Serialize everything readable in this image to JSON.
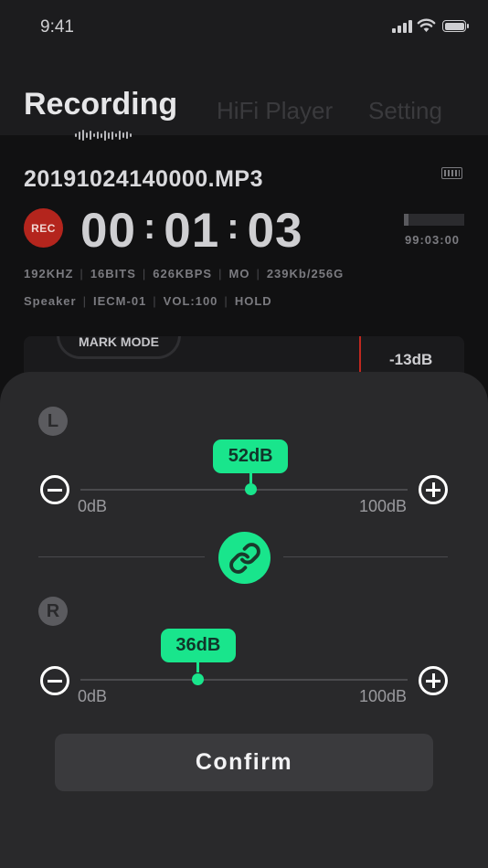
{
  "status_bar": {
    "time": "9:41"
  },
  "tabs": [
    {
      "label": "Recording",
      "active": true
    },
    {
      "label": "HiFi Player",
      "active": false
    },
    {
      "label": "Setting",
      "active": false
    }
  ],
  "recording": {
    "filename": "20191024140000.MP3",
    "rec_badge": "REC",
    "timer": {
      "hours": "00",
      "minutes": "01",
      "seconds": "03"
    },
    "remaining": "99:03:00",
    "level_fraction": 0.08,
    "info_line1": [
      "192KHZ",
      "16BITS",
      "626KBPS",
      "MO",
      "239Kb/256G"
    ],
    "info_line2": [
      "Speaker",
      "IECM-01",
      "VOL:100",
      "HOLD"
    ],
    "mark_mode": "MARK MODE",
    "db_level": "-13dB"
  },
  "gain_sheet": {
    "left": {
      "channel": "L",
      "value_label": "52dB",
      "value": 52,
      "min_label": "0dB",
      "max_label": "100dB"
    },
    "right": {
      "channel": "R",
      "value_label": "36dB",
      "value": 36,
      "min_label": "0dB",
      "max_label": "100dB"
    },
    "linked": true,
    "confirm_label": "Confirm"
  },
  "colors": {
    "accent": "#19e58c",
    "rec_red": "#b4251d",
    "sheet_bg": "#29292b"
  }
}
